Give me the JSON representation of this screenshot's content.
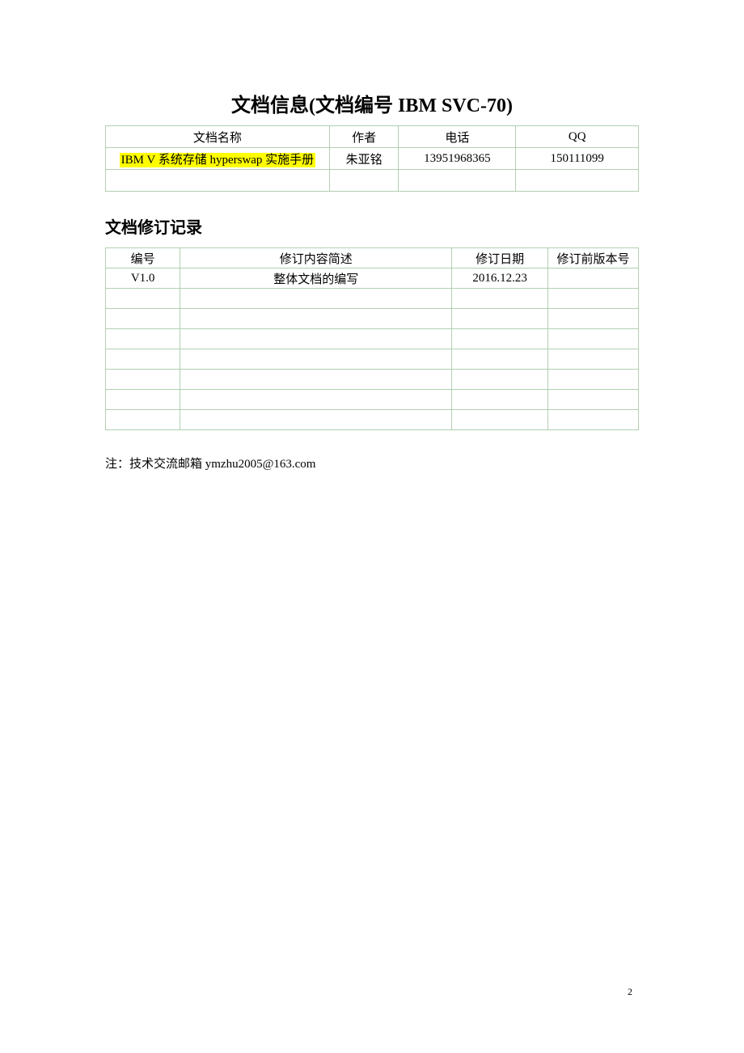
{
  "title": "文档信息(文档编号 IBM SVC-70)",
  "infoTable": {
    "headers": {
      "name": "文档名称",
      "author": "作者",
      "phone": "电话",
      "qq": "QQ"
    },
    "rows": [
      {
        "name": "IBM V 系统存储 hyperswap 实施手册",
        "author": "朱亚铭",
        "phone": "13951968365",
        "qq": "150111099"
      },
      {
        "name": "",
        "author": "",
        "phone": "",
        "qq": ""
      }
    ]
  },
  "revTitle": "文档修订记录",
  "revTable": {
    "headers": {
      "id": "编号",
      "desc": "修订内容简述",
      "date": "修订日期",
      "prev": "修订前版本号"
    },
    "rows": [
      {
        "id": "V1.0",
        "desc": "整体文档的编写",
        "date": "2016.12.23",
        "prev": ""
      },
      {
        "id": "",
        "desc": "",
        "date": "",
        "prev": ""
      },
      {
        "id": "",
        "desc": "",
        "date": "",
        "prev": ""
      },
      {
        "id": "",
        "desc": "",
        "date": "",
        "prev": ""
      },
      {
        "id": "",
        "desc": "",
        "date": "",
        "prev": ""
      },
      {
        "id": "",
        "desc": "",
        "date": "",
        "prev": ""
      },
      {
        "id": "",
        "desc": "",
        "date": "",
        "prev": ""
      },
      {
        "id": "",
        "desc": "",
        "date": "",
        "prev": ""
      }
    ]
  },
  "note": "注：技术交流邮箱 ymzhu2005@163.com",
  "pageNumber": "2"
}
